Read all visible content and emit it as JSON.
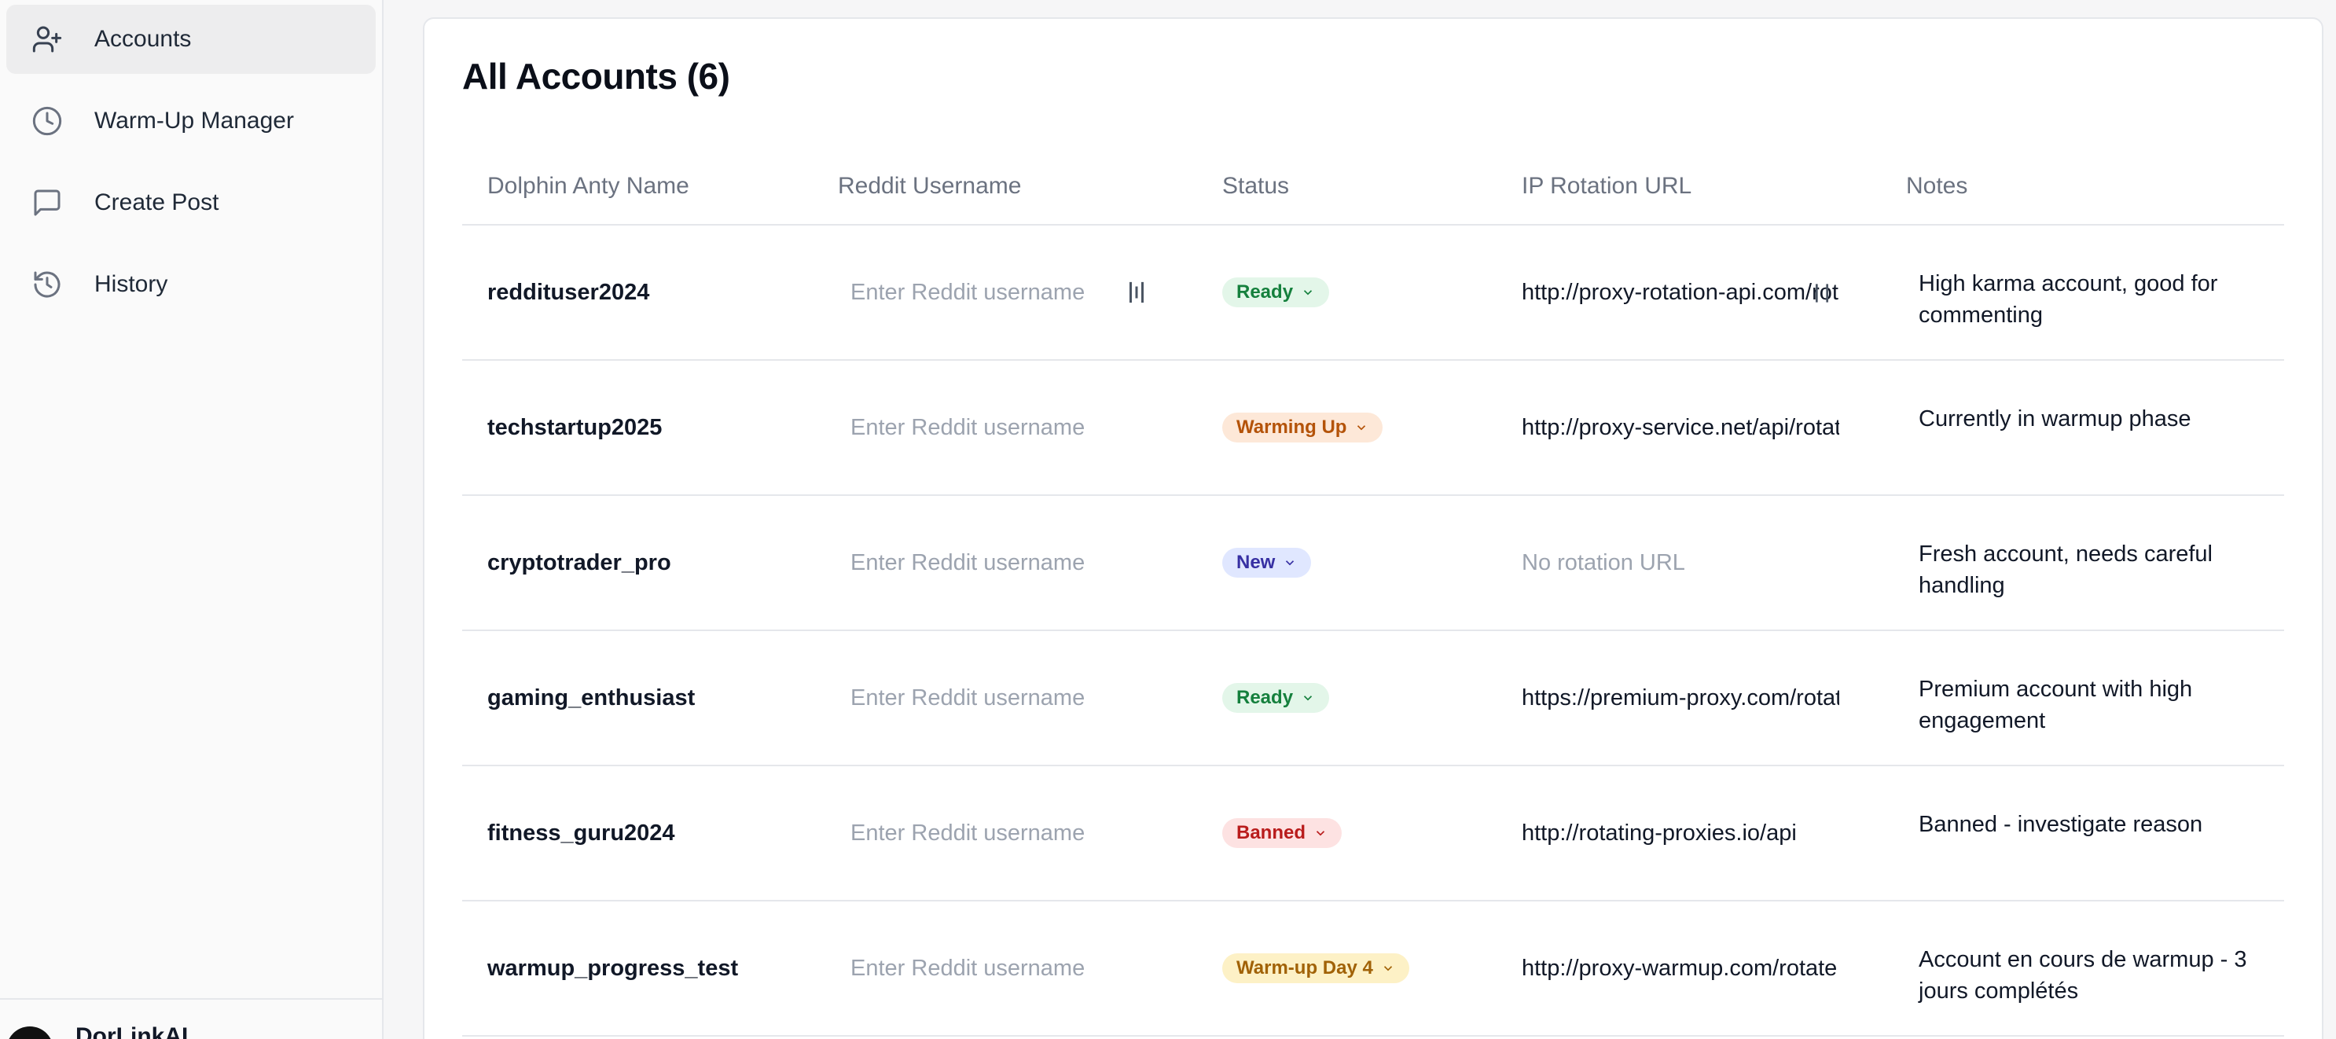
{
  "sidebar": {
    "items": [
      {
        "label": "Accounts",
        "icon": "user-plus-icon",
        "active": true
      },
      {
        "label": "Warm-Up Manager",
        "icon": "clock-icon",
        "active": false
      },
      {
        "label": "Create Post",
        "icon": "message-square-icon",
        "active": false
      },
      {
        "label": "History",
        "icon": "history-icon",
        "active": false
      }
    ],
    "user": {
      "name": "DorLinkAI"
    }
  },
  "main": {
    "title": "All Accounts (6)",
    "columns": [
      "Dolphin Anty Name",
      "Reddit Username",
      "Status",
      "IP Rotation URL",
      "Notes"
    ],
    "username_placeholder": "Enter Reddit username",
    "rows": [
      {
        "name": "reddituser2024",
        "status": "Ready",
        "status_color": "#15803d",
        "url": "http://proxy-rotation-api.com/rotate",
        "notes": "High karma account, good for commenting"
      },
      {
        "name": "techstartup2025",
        "status": "Warming Up",
        "status_color": "#b45309",
        "url": "http://proxy-service.net/api/rotate",
        "notes": "Currently in warmup phase"
      },
      {
        "name": "cryptotrader_pro",
        "status": "New",
        "status_color": "#3730a3",
        "url": "No rotation URL",
        "notes": "Fresh account, needs careful handling"
      },
      {
        "name": "gaming_enthusiast",
        "status": "Ready",
        "status_color": "#15803d",
        "url": "https://premium-proxy.com/rotate",
        "notes": "Premium account with high engagement"
      },
      {
        "name": "fitness_guru2024",
        "status": "Banned",
        "status_color": "#b91c1c",
        "url": "http://rotating-proxies.io/api",
        "notes": "Banned - investigate reason"
      },
      {
        "name": "warmup_progress_test",
        "status": "Warm-up Day 4",
        "status_color": "#a16207",
        "url": "http://proxy-warmup.com/rotate",
        "notes": "Account en cours de warmup - 3 jours complétés"
      }
    ]
  }
}
